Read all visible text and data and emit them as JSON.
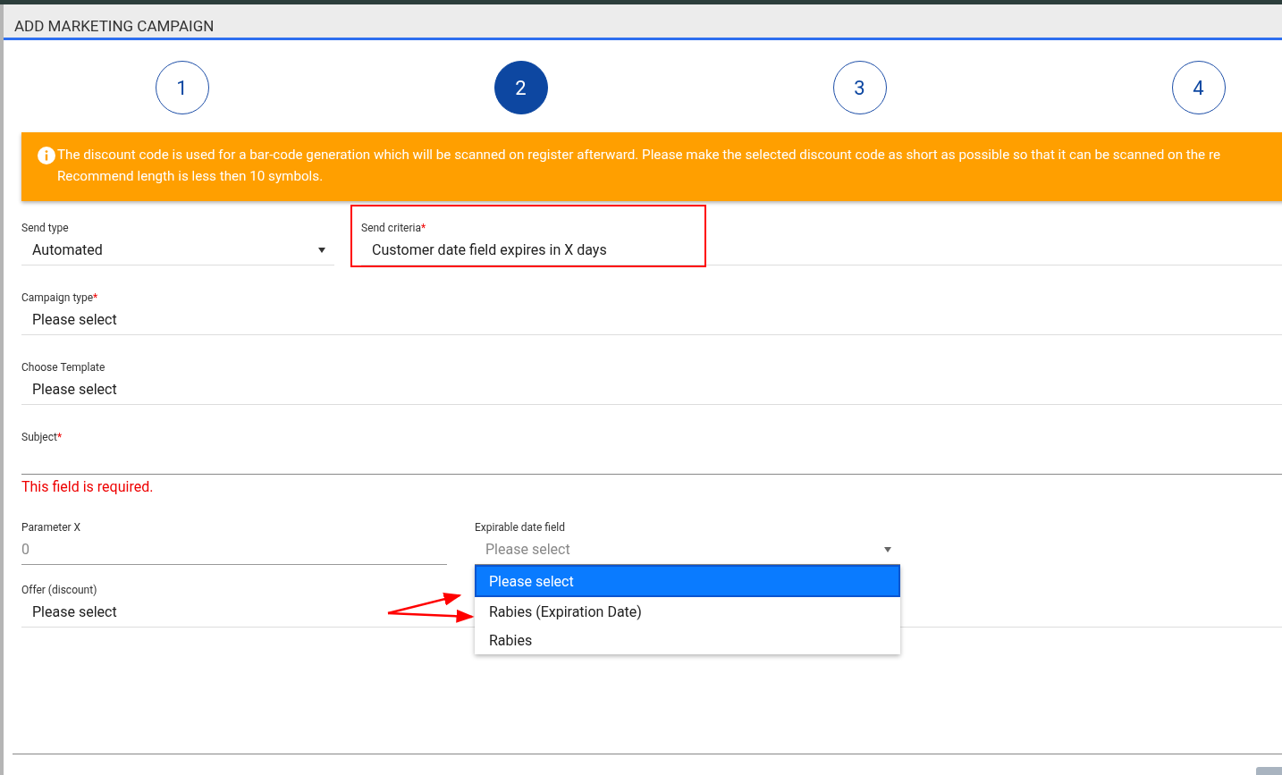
{
  "dialog": {
    "title": "ADD MARKETING CAMPAIGN"
  },
  "steps": [
    {
      "label": "1",
      "selected": false
    },
    {
      "label": "2",
      "selected": true
    },
    {
      "label": "3",
      "selected": false
    },
    {
      "label": "4",
      "selected": false
    }
  ],
  "notice": {
    "lines": [
      "The discount code is used for a bar-code generation which will be scanned on register afterward. Please make the selected discount code as short as possible so that it can be scanned on the re",
      "Recommend length is less then 10 symbols."
    ]
  },
  "send_type": {
    "label": "Send type",
    "value": "Automated"
  },
  "send_criteria": {
    "label": "Send criteria",
    "required_mark": "*",
    "value": "Customer date field expires in X days"
  },
  "campaign_type": {
    "label": "Campaign type",
    "required_mark": "*",
    "value": "Please select"
  },
  "choose_template": {
    "label": "Choose Template",
    "value": "Please select"
  },
  "subject": {
    "label": "Subject",
    "required_mark": "*",
    "error": "This field is required."
  },
  "parameter_x": {
    "label": "Parameter X",
    "placeholder": "0"
  },
  "expirable_date_field": {
    "label": "Expirable date field",
    "placeholder": "Please select",
    "expanded": true,
    "options": [
      {
        "label": "Please select",
        "selected": true
      },
      {
        "label": "Rabies (Expiration Date)",
        "selected": false
      },
      {
        "label": "Rabies",
        "selected": false
      }
    ]
  },
  "offer": {
    "label": "Offer (discount)",
    "value": "Please select"
  }
}
